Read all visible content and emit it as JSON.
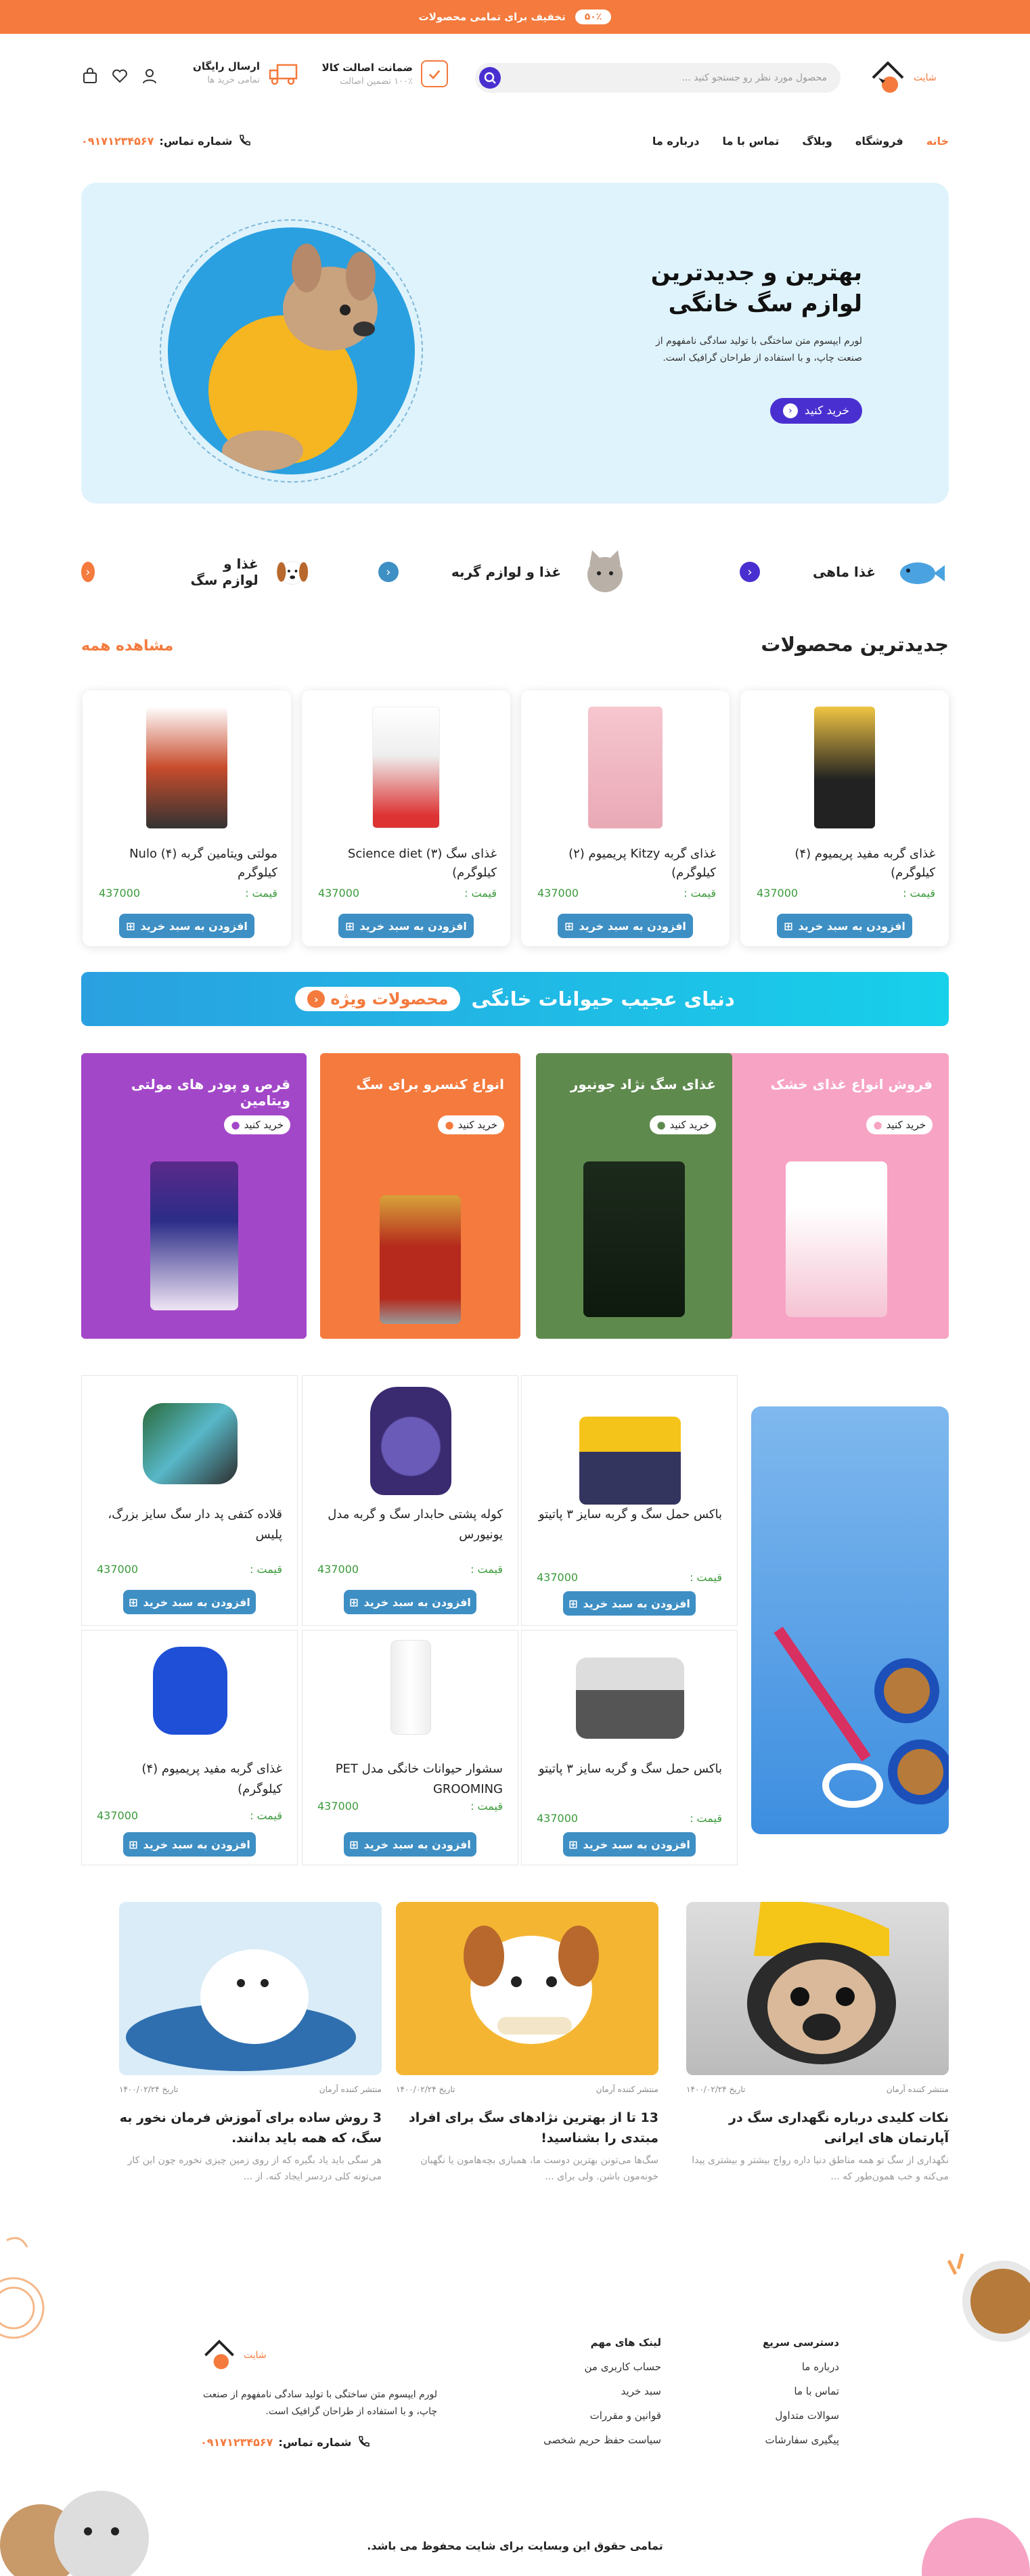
{
  "topbar": {
    "badge": "۵۰٪",
    "text": "تخفیف برای تمامی محصولات"
  },
  "header": {
    "logo_text": "شایت",
    "search_placeholder": "محصول مورد نظر رو جستجو کنید ...",
    "features": [
      {
        "title": "ضمانت اصالت کالا",
        "sub": "۱۰۰٪ تضمین اصالت"
      },
      {
        "title": "ارسال رایگان",
        "sub": "تمامی خرید ها"
      }
    ]
  },
  "nav": {
    "links": [
      "خانه",
      "فروشگاه",
      "وبلاگ",
      "تماس با ما",
      "درباره ما"
    ],
    "phone_label": "شماره تماس:",
    "phone_number": "۰۹۱۷۱۲۳۴۵۶۷"
  },
  "hero": {
    "title_line1": "بهترین و جدیدترین",
    "title_line2": "لوازم سگ خانگی",
    "desc": "لورم ایپسوم متن ساختگی با تولید سادگی نامفهوم از صنعت چاپ، و با استفاده از طراحان گرافیک است.",
    "button": "خرید کنید"
  },
  "categories": [
    {
      "label": "غذا ماهی",
      "accent": "#4a2fd0"
    },
    {
      "label": "غذا و لوازم گربه",
      "accent": "#3e8fc4"
    },
    {
      "label": "غذا و لوازم سگ",
      "accent": "#f47a3d"
    }
  ],
  "newest": {
    "title": "جدیدترین محصولات",
    "see_all": "مشاهده همه"
  },
  "price_label": "قیمت :",
  "add_to_cart": "افزودن به سبد خرید",
  "products": [
    {
      "name": "غذای گربه مفید پریمیوم (۴) کیلوگرم)",
      "price": "437000"
    },
    {
      "name": "غذای گربه Kitzy پریمیوم (۲) کیلوگرم)",
      "price": "437000"
    },
    {
      "name": "غذای سگ Science diet (۳) کیلوگرم)",
      "price": "437000"
    },
    {
      "name": "مولتی ویتامین گربه (۴) Nulo کیلوگرم",
      "price": "437000"
    }
  ],
  "banner": {
    "text": "دنیای عجیب حیوانات خانگی",
    "tag": "محصولات ویژه"
  },
  "promos": [
    {
      "title": "فروش انواع غذای خشک",
      "buy": "خرید کنید",
      "bg": "#f7a3c4"
    },
    {
      "title": "غذای سگ نژاد جونیور",
      "buy": "خرید کنید",
      "bg": "#5f8a4e"
    },
    {
      "title": "انواع کنسرو برای سگ",
      "buy": "خرید کنید",
      "bg": "#f47a3d"
    },
    {
      "title": "قرص و پودر های مولتی ویتامین",
      "buy": "خرید کنید",
      "bg": "#a347c9"
    }
  ],
  "grid": [
    {
      "name": "باکس حمل سگ و گربه سایز ۳ پاتیتو",
      "price": "437000"
    },
    {
      "name": "کوله پشتی حابدار سگ و گربه مدل یونیورس",
      "price": "437000"
    },
    {
      "name": "قلاده کتفی پد دار سگ سایز بزرگ، پلیس",
      "price": "437000"
    },
    {
      "name": "باکس حمل سگ و گربه سایز ۳ پاتیتو",
      "price": "437000"
    },
    {
      "name": "سشوار حیوانات خانگی مدل PET GROOMING",
      "price": "437000"
    },
    {
      "name": "غذای گربه مفید پریمیوم (۴) کیلوگرم)",
      "price": "437000"
    }
  ],
  "posts": [
    {
      "author": "منتشر کننده آرمان",
      "date": "تاریخ ۱۴۰۰/۰۲/۲۴",
      "title": "نکات کلیدی درباره نگهداری سگ در آپارتمان های ایرانی",
      "excerpt": "نگهداری از سگ تو همه مناطق دنیا داره رواج بیشتر و بیشتری پیدا می‌کنه و خب همون‌طور که ..."
    },
    {
      "author": "منتشر کننده آرمان",
      "date": "تاریخ ۱۴۰۰/۰۲/۲۴",
      "title": "13 تا از بهترین نژادهای سگ برای افراد مبتدی را بشناسید!",
      "excerpt": "سگ‌ها می‌تونن بهترین دوست ما، همبازی بچه‌هامون یا نگهبان خونه‌مون باشن. ولی برای ..."
    },
    {
      "author": "منتشر کننده آرمان",
      "date": "تاریخ ۱۴۰۰/۰۲/۲۴",
      "title": "3 روش ساده برای آموزش فرمان نخور به سگ، که همه باید بدانند.",
      "excerpt": "هر سگی باید یاد بگیره که از روی زمین چیزی نخوره چون این کار می‌تونه کلی دردسر ایجاد کنه. از ..."
    }
  ],
  "footer": {
    "quick_title": "دسترسی سریع",
    "quick": [
      "درباره ما",
      "تماس با ما",
      "سوالات متداول",
      "پیگیری سفارشات"
    ],
    "links_title": "لینک های مهم",
    "links": [
      "حساب کاربری من",
      "سبد خرید",
      "قوانین و مقررات",
      "سیاست حفظ حریم شخصی"
    ],
    "logo_text": "شایت",
    "about": "لورم ایپسوم متن ساختگی با تولید سادگی نامفهوم از صنعت چاپ، و با استفاده از طراحان گرافیک است.",
    "phone_label": "شماره تماس:",
    "phone_number": "۰۹۱۷۱۲۳۴۵۶۷",
    "copyright": "تمامی حقوق این وبسایت برای شایت محفوظ می باشد."
  },
  "colors": {
    "accent": "#f47a3d",
    "primary": "#4a2fd0",
    "blue": "#3e8fc4",
    "green": "#3a9a3a"
  }
}
